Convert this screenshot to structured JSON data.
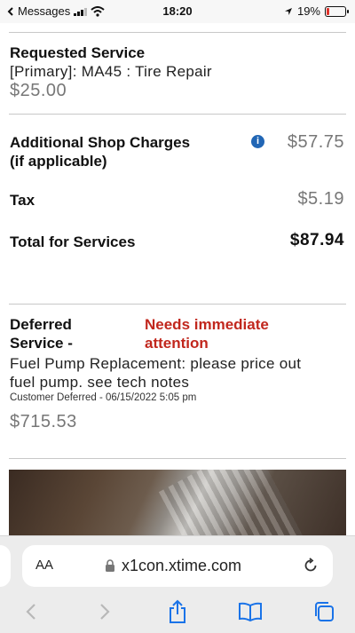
{
  "status_bar": {
    "back_app": "Messages",
    "time": "18:20",
    "battery": "19%"
  },
  "requested_service": {
    "heading": "Requested Service",
    "line": "[Primary]: MA45 : Tire Repair",
    "price": "$25.00"
  },
  "additional_charges": {
    "label_line1": "Additional Shop Charges",
    "label_line2": "(if applicable)",
    "amount": "$57.75"
  },
  "tax": {
    "label": "Tax",
    "amount": "$5.19"
  },
  "total": {
    "label": "Total for Services",
    "amount": "$87.94"
  },
  "deferred": {
    "label_line1": "Deferred",
    "label_line2": "Service -",
    "alert_line1": "Needs immediate",
    "alert_line2": "attention",
    "desc_line1": "Fuel Pump Replacement: please price out",
    "desc_line2": "fuel pump. see tech notes",
    "meta": "Customer Deferred - 06/15/2022 5:05 pm",
    "price": "$715.53"
  },
  "browser": {
    "aa_label": "AA",
    "url": "x1con.xtime.com"
  },
  "colors": {
    "accent_red": "#c1271d",
    "info_blue": "#2166b5",
    "ios_blue": "#1a73e8"
  }
}
